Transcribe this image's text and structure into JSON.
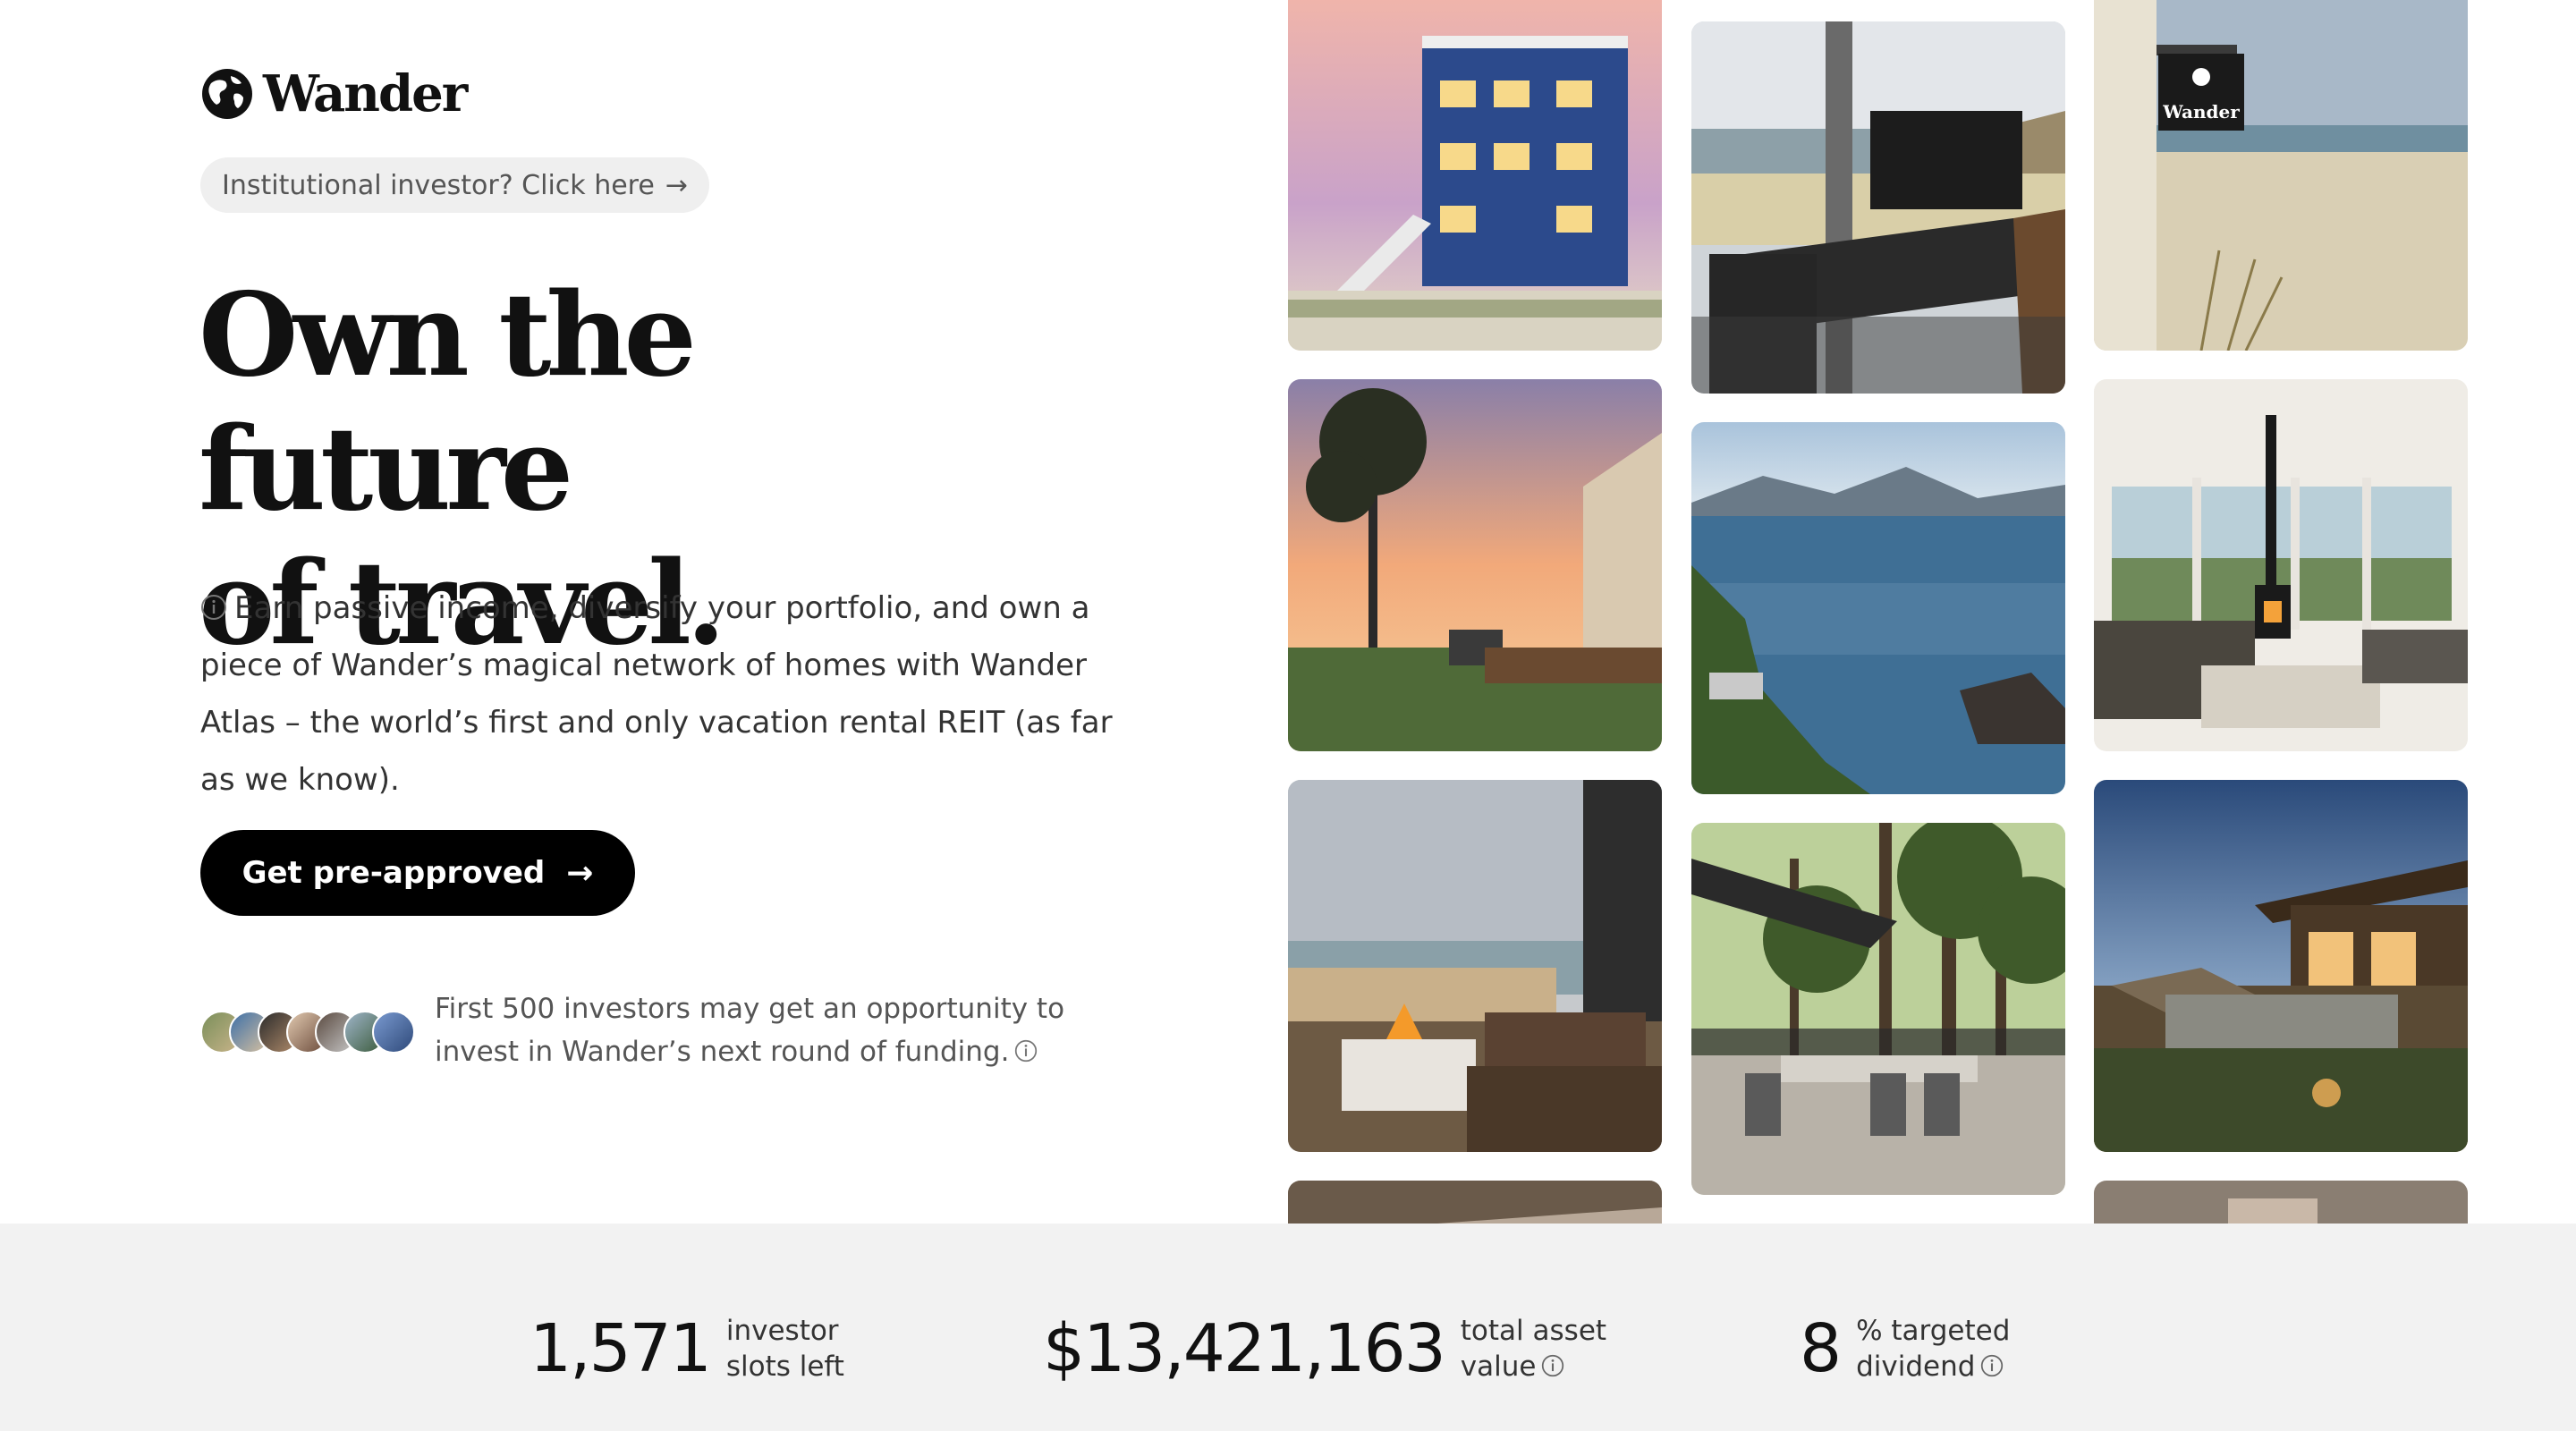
{
  "brand": {
    "name": "Wander",
    "logo_icon": "globe-icon"
  },
  "hero": {
    "institutional_link": "Institutional investor? Click here",
    "headline_line1": "Own the future",
    "headline_line2": "of travel.",
    "description": "Earn passive income, diversify your portfolio, and own a piece of Wander’s magical network of homes with Wander Atlas – the world’s first and only vacation rental REIT (as far as we know).",
    "cta_label": "Get pre-approved",
    "investors_note": "First 500 investors may get an opportunity to invest in Wander’s next round of funding."
  },
  "photo_sign_text": "Wander",
  "stats": [
    {
      "value": "1,571",
      "label_line1": "investor",
      "label_line2": "slots left"
    },
    {
      "value": "$13,421,163",
      "label_line1": "total asset",
      "label_line2": "value"
    },
    {
      "value": "8",
      "label_line1": "% targeted",
      "label_line2": "dividend"
    }
  ],
  "colors": {
    "cta_bg": "#000000",
    "stats_bg": "#f2f2f2",
    "pill_bg": "#efefef"
  }
}
